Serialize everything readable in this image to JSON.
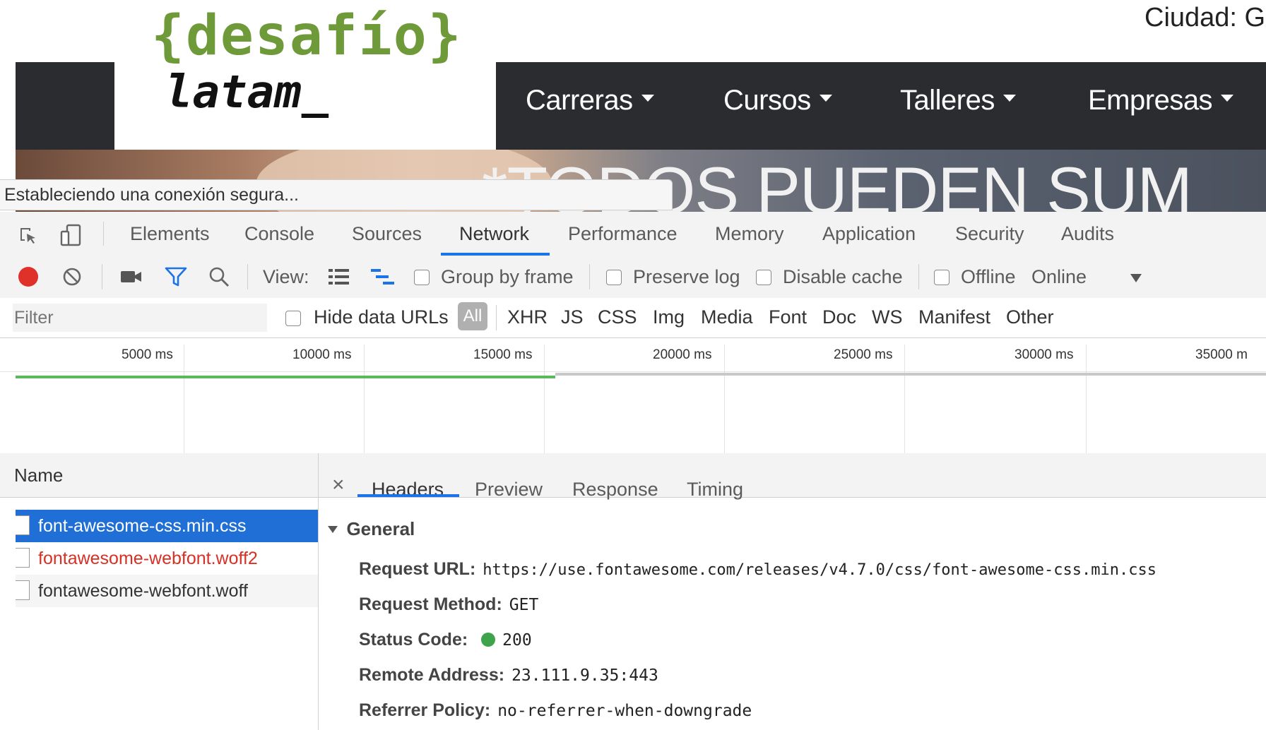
{
  "site": {
    "logo_top": "{desafío}",
    "logo_bottom": "latam_",
    "city_label": "Ciudad: G",
    "nav": [
      "Carreras",
      "Cursos",
      "Talleres",
      "Empresas"
    ],
    "hero_text": "*TODOS PUEDEN SUM",
    "status_text": "Estableciendo una conexión segura..."
  },
  "devtools": {
    "tabs": [
      "Elements",
      "Console",
      "Sources",
      "Network",
      "Performance",
      "Memory",
      "Application",
      "Security",
      "Audits"
    ],
    "active_tab": "Network",
    "toolbar": {
      "view_label": "View:",
      "group_by_frame": "Group by frame",
      "preserve_log": "Preserve log",
      "disable_cache": "Disable cache",
      "offline": "Offline",
      "throttle_value": "Online"
    },
    "filter": {
      "placeholder": "Filter",
      "hide_data_urls": "Hide data URLs",
      "types": [
        "All",
        "XHR",
        "JS",
        "CSS",
        "Img",
        "Media",
        "Font",
        "Doc",
        "WS",
        "Manifest",
        "Other"
      ]
    },
    "timeline": {
      "ticks": [
        "5000 ms",
        "10000 ms",
        "15000 ms",
        "20000 ms",
        "25000 ms",
        "30000 ms",
        "35000 m"
      ]
    },
    "requests": {
      "column_name": "Name",
      "items": [
        {
          "name": "font-awesome-css.min.css",
          "selected": true,
          "error": false
        },
        {
          "name": "fontawesome-webfont.woff2",
          "selected": false,
          "error": true
        },
        {
          "name": "fontawesome-webfont.woff",
          "selected": false,
          "error": false
        }
      ]
    },
    "detail": {
      "close_glyph": "×",
      "tabs": [
        "Headers",
        "Preview",
        "Response",
        "Timing"
      ],
      "active_tab": "Headers",
      "section_title": "General",
      "general": {
        "request_url_label": "Request URL:",
        "request_url": "https://use.fontawesome.com/releases/v4.7.0/css/font-awesome-css.min.css",
        "request_method_label": "Request Method:",
        "request_method": "GET",
        "status_code_label": "Status Code:",
        "status_code": "200",
        "remote_address_label": "Remote Address:",
        "remote_address": "23.111.9.35:443",
        "referrer_policy_label": "Referrer Policy:",
        "referrer_policy": "no-referrer-when-downgrade"
      }
    }
  },
  "colors": {
    "logo_green": "#6f9a3a",
    "nav_dark": "#2b2c30",
    "record_red": "#e0302a",
    "filter_blue": "#1a73e8",
    "selected_blue": "#1f6fd6",
    "error_red": "#d93025",
    "status_green": "#3ea34b",
    "timeline_green": "#5cb85c"
  }
}
